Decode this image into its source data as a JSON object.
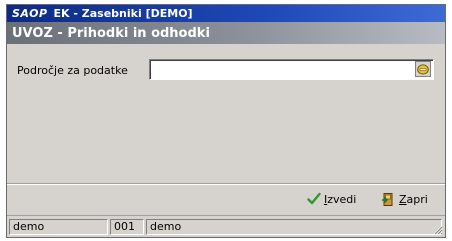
{
  "titlebar": {
    "logo": "SAOP",
    "title": "EK - Zasebniki [DEMO]"
  },
  "subtitle": "UVOZ - Prihodki in odhodki",
  "form": {
    "field_label": "Področje za podatke",
    "field_value": ""
  },
  "actions": {
    "run": {
      "label_prefix": "",
      "hotkey": "I",
      "label_rest": "zvedi"
    },
    "close": {
      "label_prefix": "",
      "hotkey": "Z",
      "label_rest": "apri"
    }
  },
  "statusbar": {
    "user": "demo",
    "code": "001",
    "company": "demo"
  },
  "colors": {
    "titlebar": "#0c2a86",
    "subtitle": "#6b6f78",
    "window_bg": "#d6d3ce",
    "check_green": "#2e9a2e"
  },
  "icons": {
    "browse": "folder-browse-icon",
    "run": "checkmark-icon",
    "close": "door-exit-icon",
    "grip": "resize-grip-icon"
  }
}
